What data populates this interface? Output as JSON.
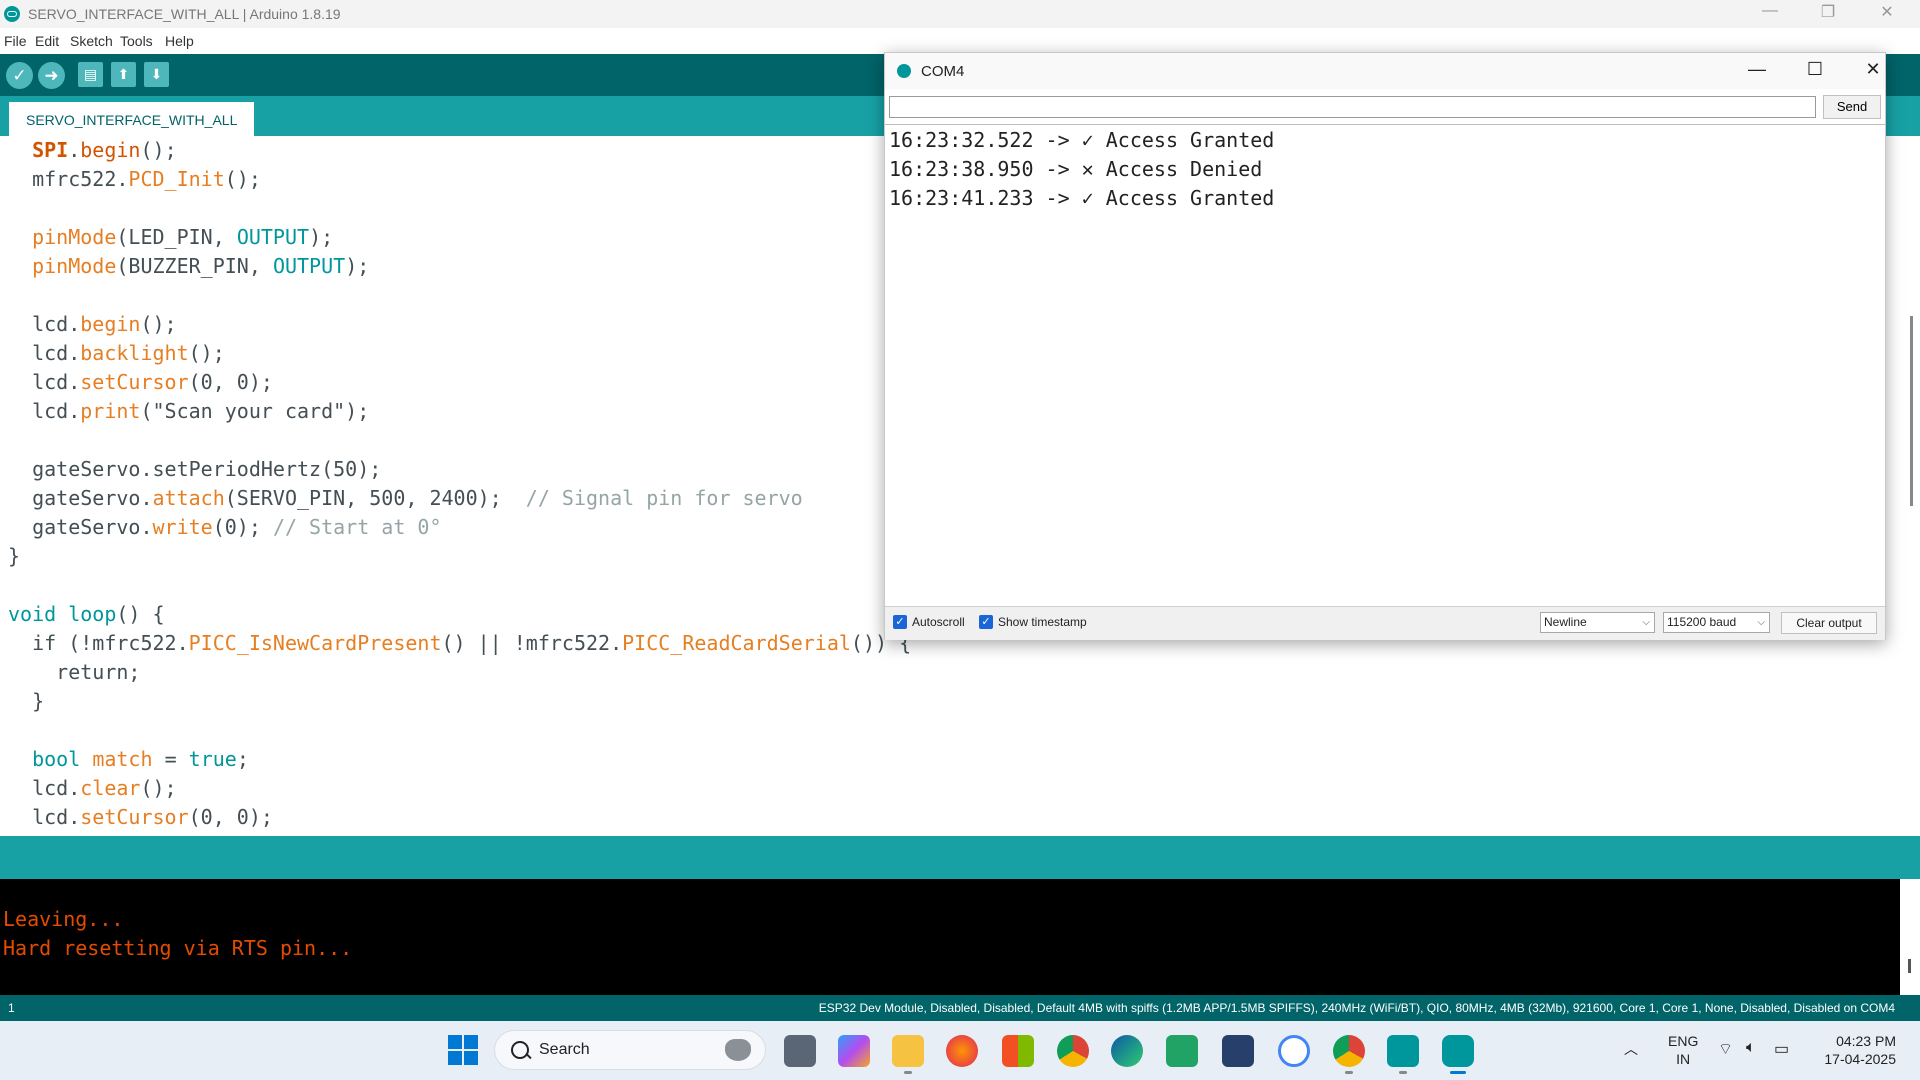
{
  "window": {
    "title": "SERVO_INTERFACE_WITH_ALL | Arduino 1.8.19",
    "minimize": "—",
    "restore": "❐",
    "close": "✕"
  },
  "menu": [
    "File",
    "Edit",
    "Sketch",
    "Tools",
    "Help"
  ],
  "toolbar": {
    "verify_icon": "check-icon",
    "upload_icon": "arrow-right-icon",
    "new_icon": "file-icon",
    "open_icon": "arrow-up-icon",
    "save_icon": "arrow-down-icon",
    "verify_glyph": "✓",
    "upload_glyph": "➜",
    "new_glyph": "▤",
    "open_glyph": "⬆",
    "save_glyph": "⬇"
  },
  "tabs": [
    {
      "label": "SERVO_INTERFACE_WITH_ALL"
    }
  ],
  "code": {
    "l1": {
      "a": "  ",
      "b": "SPI",
      "c": ".",
      "d": "begin",
      "e": "();"
    },
    "l2": {
      "a": "  mfrc522.",
      "b": "PCD_Init",
      "c": "();"
    },
    "l3": {
      "a": "  ",
      "b": "pinMode",
      "c": "(LED_PIN, ",
      "d": "OUTPUT",
      "e": ");"
    },
    "l4": {
      "a": "  ",
      "b": "pinMode",
      "c": "(BUZZER_PIN, ",
      "d": "OUTPUT",
      "e": ");"
    },
    "l5": {
      "a": "  lcd.",
      "b": "begin",
      "c": "();"
    },
    "l6": {
      "a": "  lcd.",
      "b": "backlight",
      "c": "();"
    },
    "l7": {
      "a": "  lcd.",
      "b": "setCursor",
      "c": "(0, 0);"
    },
    "l8": {
      "a": "  lcd.",
      "b": "print",
      "c": "(\"Scan your card\");"
    },
    "l9": {
      "a": "  gateServo.setPeriodHertz(50);"
    },
    "l10": {
      "a": "  gateServo.",
      "b": "attach",
      "c": "(SERVO_PIN, 500, 2400);  ",
      "d": "// Signal pin for servo"
    },
    "l11": {
      "a": "  gateServo.",
      "b": "write",
      "c": "(0); ",
      "d": "// Start at 0°"
    },
    "l12": {
      "a": "}"
    },
    "l13": {
      "a": "void",
      "b": " ",
      "c": "loop",
      "d": "() {"
    },
    "l14": {
      "a": "  if (!mfrc522.",
      "b": "PICC_IsNewCardPresent",
      "c": "() || !mfrc522.",
      "d": "PICC_ReadCardSerial",
      "e": "()) {"
    },
    "l15": {
      "a": "    return;"
    },
    "l16": {
      "a": "  }"
    },
    "l17": {
      "a": "  ",
      "b": "bool",
      "c": " ",
      "d": "match",
      "e": " = ",
      "f": "true",
      "g": ";"
    },
    "l18": {
      "a": "  lcd.",
      "b": "clear",
      "c": "();"
    },
    "l19": {
      "a": "  lcd.",
      "b": "setCursor",
      "c": "(0, 0);"
    }
  },
  "console": {
    "lines": [
      "Leaving...",
      "Hard resetting via RTS pin..."
    ]
  },
  "status": {
    "line_number": "1",
    "board": "ESP32 Dev Module, Disabled, Disabled, Default 4MB with spiffs (1.2MB APP/1.5MB SPIFFS), 240MHz (WiFi/BT), QIO, 80MHz, 4MB (32Mb), 921600, Core 1, Core 1, None, Disabled, Disabled on COM4"
  },
  "serial_monitor": {
    "title": "COM4",
    "input_value": "",
    "send_label": "Send",
    "output": [
      {
        "time": "16:23:32.522",
        "arrow": " -> ",
        "icon": "checkmark-icon",
        "glyph": "✓",
        "text": " Access Granted"
      },
      {
        "time": "16:23:38.950",
        "arrow": " -> ",
        "icon": "cross-icon",
        "glyph": "✕",
        "text": " Access Denied"
      },
      {
        "time": "16:23:41.233",
        "arrow": " -> ",
        "icon": "checkmark-icon",
        "glyph": "✓",
        "text": " Access Granted"
      }
    ],
    "autoscroll_label": "Autoscroll",
    "autoscroll_checked": true,
    "timestamp_label": "Show timestamp",
    "timestamp_checked": true,
    "line_ending": "Newline",
    "baud": "115200 baud",
    "clear_label": "Clear output"
  },
  "taskbar": {
    "search_label": "Search",
    "lang": "ENG",
    "region": "IN",
    "time": "04:23 PM",
    "date": "17-04-2025"
  },
  "colors": {
    "arduino_teal": "#00979c",
    "toolbar_dark": "#006468",
    "keyword_orange": "#d35400",
    "console_text": "#e34c00"
  }
}
